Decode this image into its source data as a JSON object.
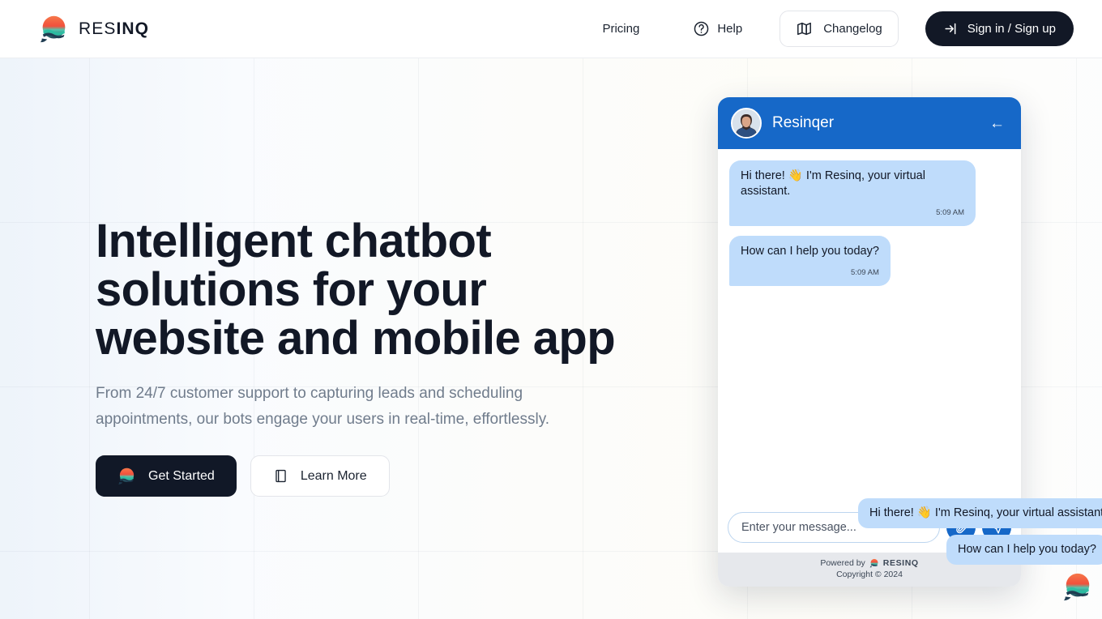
{
  "brand": {
    "name_light": "RES",
    "name_bold": "INQ",
    "logo_icon": "resinq-logo-icon"
  },
  "nav": {
    "pricing": "Pricing",
    "help": "Help",
    "help_icon": "question-circle-icon",
    "changelog": "Changelog",
    "changelog_icon": "map-icon",
    "signin": "Sign in / Sign up",
    "signin_icon": "login-arrow-icon"
  },
  "hero": {
    "title": "Intelligent chatbot\nsolutions for your\nwebsite and mobile app",
    "subtitle": "From 24/7 customer support to capturing leads and scheduling\nappointments, our bots engage your users in real-time, effortlessly.",
    "cta_primary": "Get Started",
    "cta_primary_icon": "resinq-logo-icon",
    "cta_secondary": "Learn More",
    "cta_secondary_icon": "book-icon"
  },
  "chat": {
    "header_title": "Resinqer",
    "avatar_icon": "agent-avatar",
    "back_icon": "arrow-left-icon",
    "messages": [
      {
        "text": "Hi there! 👋 I'm Resinq, your virtual assistant.",
        "time": "5:09 AM"
      },
      {
        "text": "How can I help you today?",
        "time": "5:09 AM"
      }
    ],
    "input_placeholder": "Enter your message...",
    "input_value": "",
    "attach_icon": "attachment-icon",
    "send_icon": "send-icon",
    "powered_prefix": "Powered by",
    "powered_brand": "RESINQ",
    "copyright": "Copyright © 2024"
  },
  "previews": [
    {
      "text": "Hi there! 👋 I'm Resinq, your virtual assistant."
    },
    {
      "text": "How can I help you today?"
    }
  ],
  "launcher": {
    "icon": "resinq-chat-launcher-icon"
  },
  "colors": {
    "brand_dark": "#121826",
    "chat_blue": "#1668c8",
    "bubble_blue": "#bfdcfb",
    "logo_orange": "#f4603f",
    "logo_teal": "#2fc6a8"
  }
}
